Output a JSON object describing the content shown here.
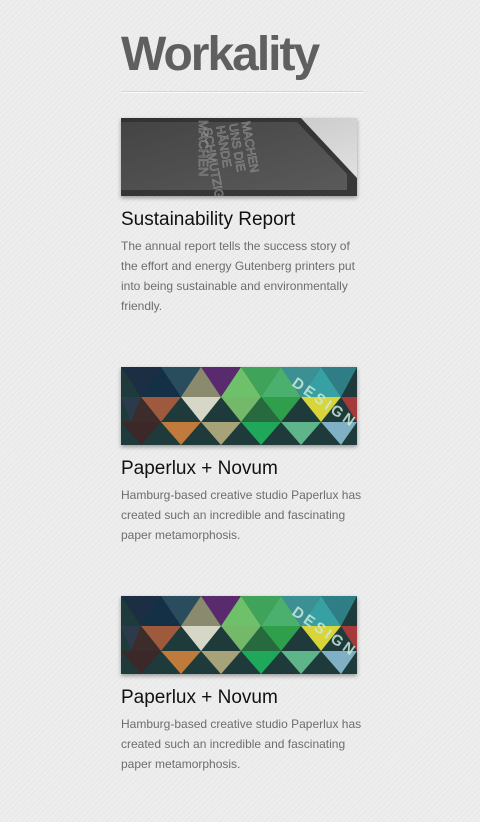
{
  "site": {
    "title": "Workality"
  },
  "articles": [
    {
      "title": "Sustainability Report",
      "description": "The annual report tells the success story of the effort and energy Gutenberg printers put into being sustainable and environmentally friendly.",
      "image_text": [
        "MACHEN",
        "UNS DIE",
        "HÄNDE",
        "SCHMUTZIG"
      ]
    },
    {
      "title": "Paperlux + Novum",
      "description": "Hamburg-based creative studio Paperlux has created such an incredible and fascinating paper metamorphosis.",
      "image_text": "DESIGN"
    },
    {
      "title": "Paperlux + Novum",
      "description": "Hamburg-based creative studio Paperlux has created such an incredible and fascinating paper metamorphosis.",
      "image_text": "DESIGN"
    }
  ],
  "colors": {
    "background": "#ececec",
    "title": "#5f5f5f",
    "heading": "#111111",
    "body_text": "#6d6d6d"
  }
}
